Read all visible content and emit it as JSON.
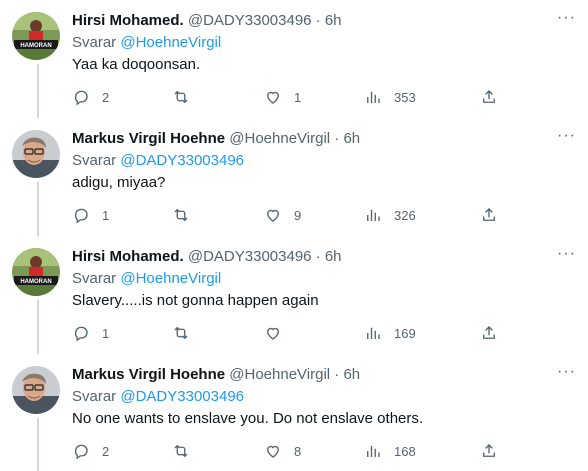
{
  "tweets": [
    {
      "name": "Hirsi Mohamed.",
      "handle": "@DADY33003496",
      "dot": "·",
      "time": "6h",
      "reply_prefix": "Svarar",
      "reply_to": "@HoehneVirgil",
      "text": "Yaa ka doqoonsan.",
      "replies": "2",
      "retweets": "",
      "likes": "1",
      "views": "353",
      "avatar": "hirsi-avatar",
      "avatar_text": "HAMORAN"
    },
    {
      "name": "Markus Virgil Hoehne",
      "handle": "@HoehneVirgil",
      "dot": "·",
      "time": "6h",
      "reply_prefix": "Svarar",
      "reply_to": "@DADY33003496",
      "text": "adigu, miyaa?",
      "replies": "1",
      "retweets": "",
      "likes": "9",
      "views": "326",
      "avatar": "markus-avatar"
    },
    {
      "name": "Hirsi Mohamed.",
      "handle": "@DADY33003496",
      "dot": "·",
      "time": "6h",
      "reply_prefix": "Svarar",
      "reply_to": "@HoehneVirgil",
      "text": "Slavery.....is not gonna happen again",
      "replies": "1",
      "retweets": "",
      "likes": "",
      "views": "169",
      "avatar": "hirsi-avatar",
      "avatar_text": "HAMORAN"
    },
    {
      "name": "Markus Virgil Hoehne",
      "handle": "@HoehneVirgil",
      "dot": "·",
      "time": "6h",
      "reply_prefix": "Svarar",
      "reply_to": "@DADY33003496",
      "text": "No one wants to enslave you. Do not enslave others.",
      "replies": "2",
      "retweets": "",
      "likes": "8",
      "views": "168",
      "avatar": "markus-avatar"
    }
  ],
  "more_glyph": "···",
  "colors": {
    "link": "#1d9bf0",
    "muted": "#536471",
    "text": "#0f1419",
    "thread_line": "#cfd9de"
  }
}
